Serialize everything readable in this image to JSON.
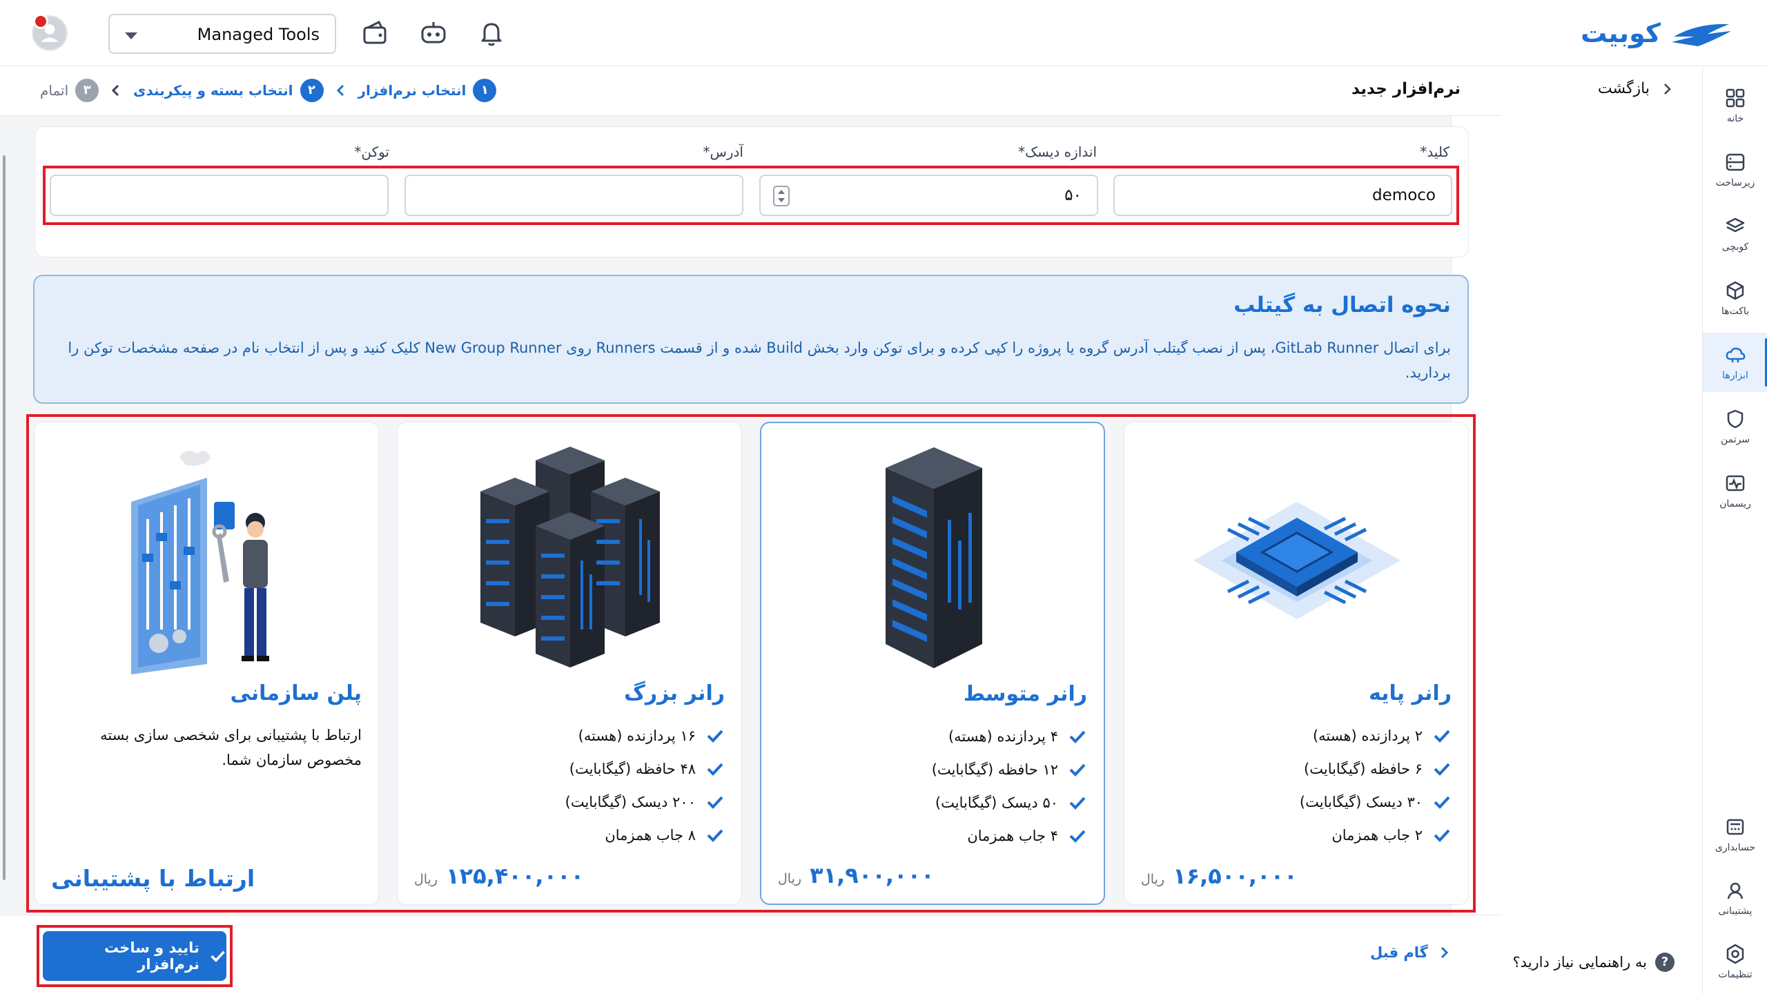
{
  "app": {
    "brand": "کوبیت"
  },
  "workspace": {
    "selected": "Managed Tools"
  },
  "sidebar": {
    "items": [
      {
        "label": "خانه",
        "icon": "grid-icon"
      },
      {
        "label": "زیرساخت",
        "icon": "server-icon"
      },
      {
        "label": "کوبچی",
        "icon": "layers-icon"
      },
      {
        "label": "باکت‌ها",
        "icon": "box-icon"
      },
      {
        "label": "ابزارها",
        "icon": "cloud-icon"
      },
      {
        "label": "سرتمن",
        "icon": "shield-icon"
      },
      {
        "label": "ریسمان",
        "icon": "pulse-icon"
      }
    ],
    "bottom": [
      {
        "label": "حسابداری",
        "icon": "calculator-icon"
      },
      {
        "label": "پشتیبانی",
        "icon": "headset-icon"
      },
      {
        "label": "تنظیمات",
        "icon": "settings-icon"
      }
    ],
    "active_color": "#1d6fd1"
  },
  "backpanel": {
    "back_label": "بازگشت",
    "help_label": "به راهنمایی نیاز دارید؟",
    "help_icon": "?"
  },
  "header": {
    "title": "نرم‌افزار جدید",
    "steps": [
      {
        "num": "۱",
        "label": "انتخاب نرم‌افزار",
        "state": "done"
      },
      {
        "num": "۲",
        "label": "انتخاب بسته و پیکربندی",
        "state": "active"
      },
      {
        "num": "۳",
        "label": "اتمام",
        "state": "pending"
      }
    ]
  },
  "form": {
    "key": {
      "label": "کلید*",
      "value": "democo"
    },
    "disk": {
      "label": "اندازه دیسک*",
      "value": "۵۰"
    },
    "address": {
      "label": "آدرس*",
      "value": ""
    },
    "token": {
      "label": "توکن*",
      "value": ""
    }
  },
  "info": {
    "title": "نحوه اتصال به گیتلب",
    "text": "برای اتصال GitLab Runner، پس از نصب گیتلب آدرس گروه یا پروژه را کپی کرده و برای توکن وارد بخش Build شده و از قسمت Runners روی New Group Runner کلیک کنید و پس از انتخاب نام در صفحه مشخصات توکن را بردارید."
  },
  "plans": [
    {
      "title": "رانر پایه",
      "features": [
        "۲ پردازنده (هسته)",
        "۶ حافظه (گیگابایت)",
        "۳۰ دیسک (گیگابایت)",
        "۲ جاب همزمان"
      ],
      "price": "۱۶,۵۰۰,۰۰۰",
      "unit": "ریال",
      "image": "chip-illustration",
      "selected": false
    },
    {
      "title": "رانر متوسط",
      "features": [
        "۴ پردازنده (هسته)",
        "۱۲ حافظه (گیگابایت)",
        "۵۰ دیسک (گیگابایت)",
        "۴ جاب همزمان"
      ],
      "price": "۳۱,۹۰۰,۰۰۰",
      "unit": "ریال",
      "image": "server-rack-illustration",
      "selected": true
    },
    {
      "title": "رانر بزرگ",
      "features": [
        "۱۶ پردازنده (هسته)",
        "۴۸ حافظه (گیگابایت)",
        "۲۰۰ دیسک (گیگابایت)",
        "۸ جاب همزمان"
      ],
      "price": "۱۲۵,۴۰۰,۰۰۰",
      "unit": "ریال",
      "image": "server-cluster-illustration",
      "selected": false
    },
    {
      "title": "پلن سازمانی",
      "description": "ارتباط با پشتیبانی برای شخصی سازی بسته مخصوص سازمان شما.",
      "cta": "ارتباط با پشتیبانی",
      "image": "support-engineer-illustration",
      "selected": false
    }
  ],
  "footer": {
    "confirm_label": "تایید و ساخت نرم‌افزار",
    "prev_label": "گام قبل"
  },
  "colors": {
    "primary": "#1d6fd1",
    "highlight": "#e11d2a",
    "info_bg": "#e3eefa"
  }
}
